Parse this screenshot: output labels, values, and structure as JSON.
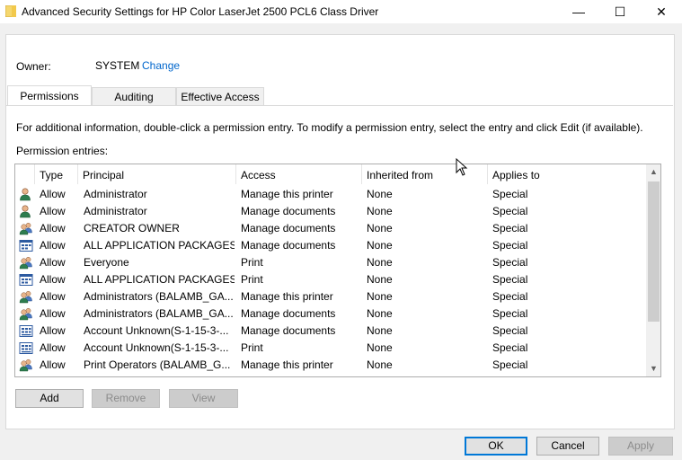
{
  "window": {
    "title": "Advanced Security Settings for HP Color LaserJet 2500 PCL6 Class Driver",
    "minimize_glyph": "—",
    "maximize_glyph": "☐",
    "close_glyph": "✕"
  },
  "owner": {
    "label": "Owner:",
    "value": "SYSTEM",
    "change_link": "Change"
  },
  "tabs": [
    {
      "label": "Permissions",
      "active": true
    },
    {
      "label": "Auditing",
      "active": false
    },
    {
      "label": "Effective Access",
      "active": false
    }
  ],
  "info_text": "For additional information, double-click a permission entry. To modify a permission entry, select the entry and click Edit (if available).",
  "entries_label": "Permission entries:",
  "columns": {
    "type": "Type",
    "principal": "Principal",
    "access": "Access",
    "inherited": "Inherited from",
    "applies": "Applies to"
  },
  "entries": [
    {
      "icon": "user-icon",
      "type": "Allow",
      "principal": "Administrator",
      "access": "Manage this printer",
      "inherited": "None",
      "applies": "Special"
    },
    {
      "icon": "user-icon",
      "type": "Allow",
      "principal": "Administrator",
      "access": "Manage documents",
      "inherited": "None",
      "applies": "Special"
    },
    {
      "icon": "group-icon",
      "type": "Allow",
      "principal": "CREATOR OWNER",
      "access": "Manage documents",
      "inherited": "None",
      "applies": "Special"
    },
    {
      "icon": "app-package-icon",
      "type": "Allow",
      "principal": "ALL APPLICATION PACKAGES",
      "access": "Manage documents",
      "inherited": "None",
      "applies": "Special"
    },
    {
      "icon": "group-icon",
      "type": "Allow",
      "principal": "Everyone",
      "access": "Print",
      "inherited": "None",
      "applies": "Special"
    },
    {
      "icon": "app-package-icon",
      "type": "Allow",
      "principal": "ALL APPLICATION PACKAGES",
      "access": "Print",
      "inherited": "None",
      "applies": "Special"
    },
    {
      "icon": "group-icon",
      "type": "Allow",
      "principal": "Administrators (BALAMB_GA...",
      "access": "Manage this printer",
      "inherited": "None",
      "applies": "Special"
    },
    {
      "icon": "group-icon",
      "type": "Allow",
      "principal": "Administrators (BALAMB_GA...",
      "access": "Manage documents",
      "inherited": "None",
      "applies": "Special"
    },
    {
      "icon": "unknown-account-icon",
      "type": "Allow",
      "principal": "Account Unknown(S-1-15-3-...",
      "access": "Manage documents",
      "inherited": "None",
      "applies": "Special"
    },
    {
      "icon": "unknown-account-icon",
      "type": "Allow",
      "principal": "Account Unknown(S-1-15-3-...",
      "access": "Print",
      "inherited": "None",
      "applies": "Special"
    },
    {
      "icon": "group-icon",
      "type": "Allow",
      "principal": "Print Operators (BALAMB_G...",
      "access": "Manage this printer",
      "inherited": "None",
      "applies": "Special"
    }
  ],
  "buttons": {
    "add": "Add",
    "remove": "Remove",
    "view": "View",
    "ok": "OK",
    "cancel": "Cancel",
    "apply": "Apply"
  },
  "colors": {
    "link": "#0066cc",
    "accent": "#0078d7"
  }
}
